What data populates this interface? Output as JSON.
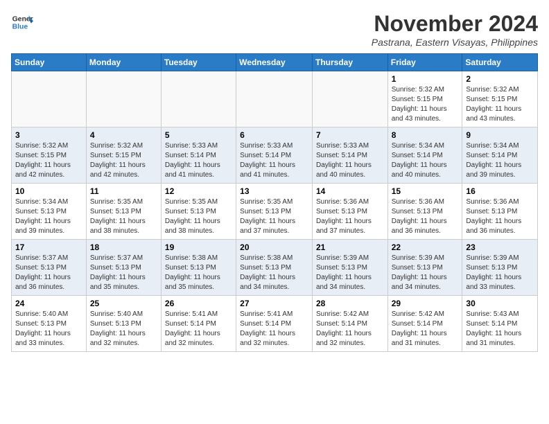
{
  "header": {
    "logo_line1": "General",
    "logo_line2": "Blue",
    "month": "November 2024",
    "location": "Pastrana, Eastern Visayas, Philippines"
  },
  "days_of_week": [
    "Sunday",
    "Monday",
    "Tuesday",
    "Wednesday",
    "Thursday",
    "Friday",
    "Saturday"
  ],
  "weeks": [
    [
      {
        "day": "",
        "info": ""
      },
      {
        "day": "",
        "info": ""
      },
      {
        "day": "",
        "info": ""
      },
      {
        "day": "",
        "info": ""
      },
      {
        "day": "",
        "info": ""
      },
      {
        "day": "1",
        "info": "Sunrise: 5:32 AM\nSunset: 5:15 PM\nDaylight: 11 hours\nand 43 minutes."
      },
      {
        "day": "2",
        "info": "Sunrise: 5:32 AM\nSunset: 5:15 PM\nDaylight: 11 hours\nand 43 minutes."
      }
    ],
    [
      {
        "day": "3",
        "info": "Sunrise: 5:32 AM\nSunset: 5:15 PM\nDaylight: 11 hours\nand 42 minutes."
      },
      {
        "day": "4",
        "info": "Sunrise: 5:32 AM\nSunset: 5:15 PM\nDaylight: 11 hours\nand 42 minutes."
      },
      {
        "day": "5",
        "info": "Sunrise: 5:33 AM\nSunset: 5:14 PM\nDaylight: 11 hours\nand 41 minutes."
      },
      {
        "day": "6",
        "info": "Sunrise: 5:33 AM\nSunset: 5:14 PM\nDaylight: 11 hours\nand 41 minutes."
      },
      {
        "day": "7",
        "info": "Sunrise: 5:33 AM\nSunset: 5:14 PM\nDaylight: 11 hours\nand 40 minutes."
      },
      {
        "day": "8",
        "info": "Sunrise: 5:34 AM\nSunset: 5:14 PM\nDaylight: 11 hours\nand 40 minutes."
      },
      {
        "day": "9",
        "info": "Sunrise: 5:34 AM\nSunset: 5:14 PM\nDaylight: 11 hours\nand 39 minutes."
      }
    ],
    [
      {
        "day": "10",
        "info": "Sunrise: 5:34 AM\nSunset: 5:13 PM\nDaylight: 11 hours\nand 39 minutes."
      },
      {
        "day": "11",
        "info": "Sunrise: 5:35 AM\nSunset: 5:13 PM\nDaylight: 11 hours\nand 38 minutes."
      },
      {
        "day": "12",
        "info": "Sunrise: 5:35 AM\nSunset: 5:13 PM\nDaylight: 11 hours\nand 38 minutes."
      },
      {
        "day": "13",
        "info": "Sunrise: 5:35 AM\nSunset: 5:13 PM\nDaylight: 11 hours\nand 37 minutes."
      },
      {
        "day": "14",
        "info": "Sunrise: 5:36 AM\nSunset: 5:13 PM\nDaylight: 11 hours\nand 37 minutes."
      },
      {
        "day": "15",
        "info": "Sunrise: 5:36 AM\nSunset: 5:13 PM\nDaylight: 11 hours\nand 36 minutes."
      },
      {
        "day": "16",
        "info": "Sunrise: 5:36 AM\nSunset: 5:13 PM\nDaylight: 11 hours\nand 36 minutes."
      }
    ],
    [
      {
        "day": "17",
        "info": "Sunrise: 5:37 AM\nSunset: 5:13 PM\nDaylight: 11 hours\nand 36 minutes."
      },
      {
        "day": "18",
        "info": "Sunrise: 5:37 AM\nSunset: 5:13 PM\nDaylight: 11 hours\nand 35 minutes."
      },
      {
        "day": "19",
        "info": "Sunrise: 5:38 AM\nSunset: 5:13 PM\nDaylight: 11 hours\nand 35 minutes."
      },
      {
        "day": "20",
        "info": "Sunrise: 5:38 AM\nSunset: 5:13 PM\nDaylight: 11 hours\nand 34 minutes."
      },
      {
        "day": "21",
        "info": "Sunrise: 5:39 AM\nSunset: 5:13 PM\nDaylight: 11 hours\nand 34 minutes."
      },
      {
        "day": "22",
        "info": "Sunrise: 5:39 AM\nSunset: 5:13 PM\nDaylight: 11 hours\nand 34 minutes."
      },
      {
        "day": "23",
        "info": "Sunrise: 5:39 AM\nSunset: 5:13 PM\nDaylight: 11 hours\nand 33 minutes."
      }
    ],
    [
      {
        "day": "24",
        "info": "Sunrise: 5:40 AM\nSunset: 5:13 PM\nDaylight: 11 hours\nand 33 minutes."
      },
      {
        "day": "25",
        "info": "Sunrise: 5:40 AM\nSunset: 5:13 PM\nDaylight: 11 hours\nand 32 minutes."
      },
      {
        "day": "26",
        "info": "Sunrise: 5:41 AM\nSunset: 5:14 PM\nDaylight: 11 hours\nand 32 minutes."
      },
      {
        "day": "27",
        "info": "Sunrise: 5:41 AM\nSunset: 5:14 PM\nDaylight: 11 hours\nand 32 minutes."
      },
      {
        "day": "28",
        "info": "Sunrise: 5:42 AM\nSunset: 5:14 PM\nDaylight: 11 hours\nand 32 minutes."
      },
      {
        "day": "29",
        "info": "Sunrise: 5:42 AM\nSunset: 5:14 PM\nDaylight: 11 hours\nand 31 minutes."
      },
      {
        "day": "30",
        "info": "Sunrise: 5:43 AM\nSunset: 5:14 PM\nDaylight: 11 hours\nand 31 minutes."
      }
    ]
  ]
}
